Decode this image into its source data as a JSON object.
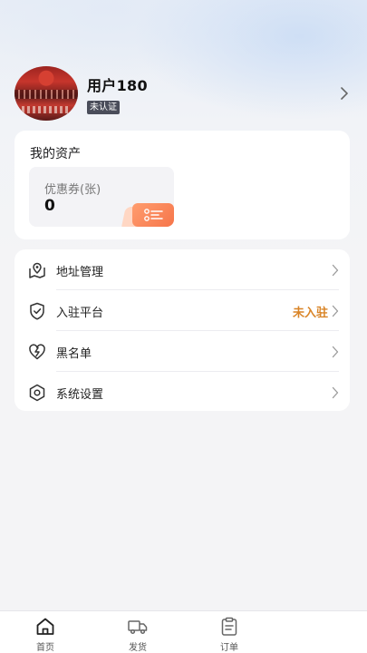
{
  "profile": {
    "name": "用户180",
    "badge": "未认证"
  },
  "assets": {
    "title": "我的资产",
    "coupon_label": "优惠券(张)",
    "coupon_value": "0",
    "accent_color": "#f6754a"
  },
  "menu": {
    "items": [
      {
        "label": "地址管理",
        "icon": "location-map-icon"
      },
      {
        "label": "入驻平台",
        "icon": "shield-check-icon",
        "status": "未入驻"
      },
      {
        "label": "黑名单",
        "icon": "broken-heart-icon"
      },
      {
        "label": "系统设置",
        "icon": "hexagon-settings-icon"
      }
    ],
    "status_color": "#d98426"
  },
  "tabbar": {
    "tabs": [
      {
        "label": "首页",
        "icon": "home-icon"
      },
      {
        "label": "发货",
        "icon": "truck-icon"
      },
      {
        "label": "订单",
        "icon": "clipboard-icon"
      }
    ]
  }
}
